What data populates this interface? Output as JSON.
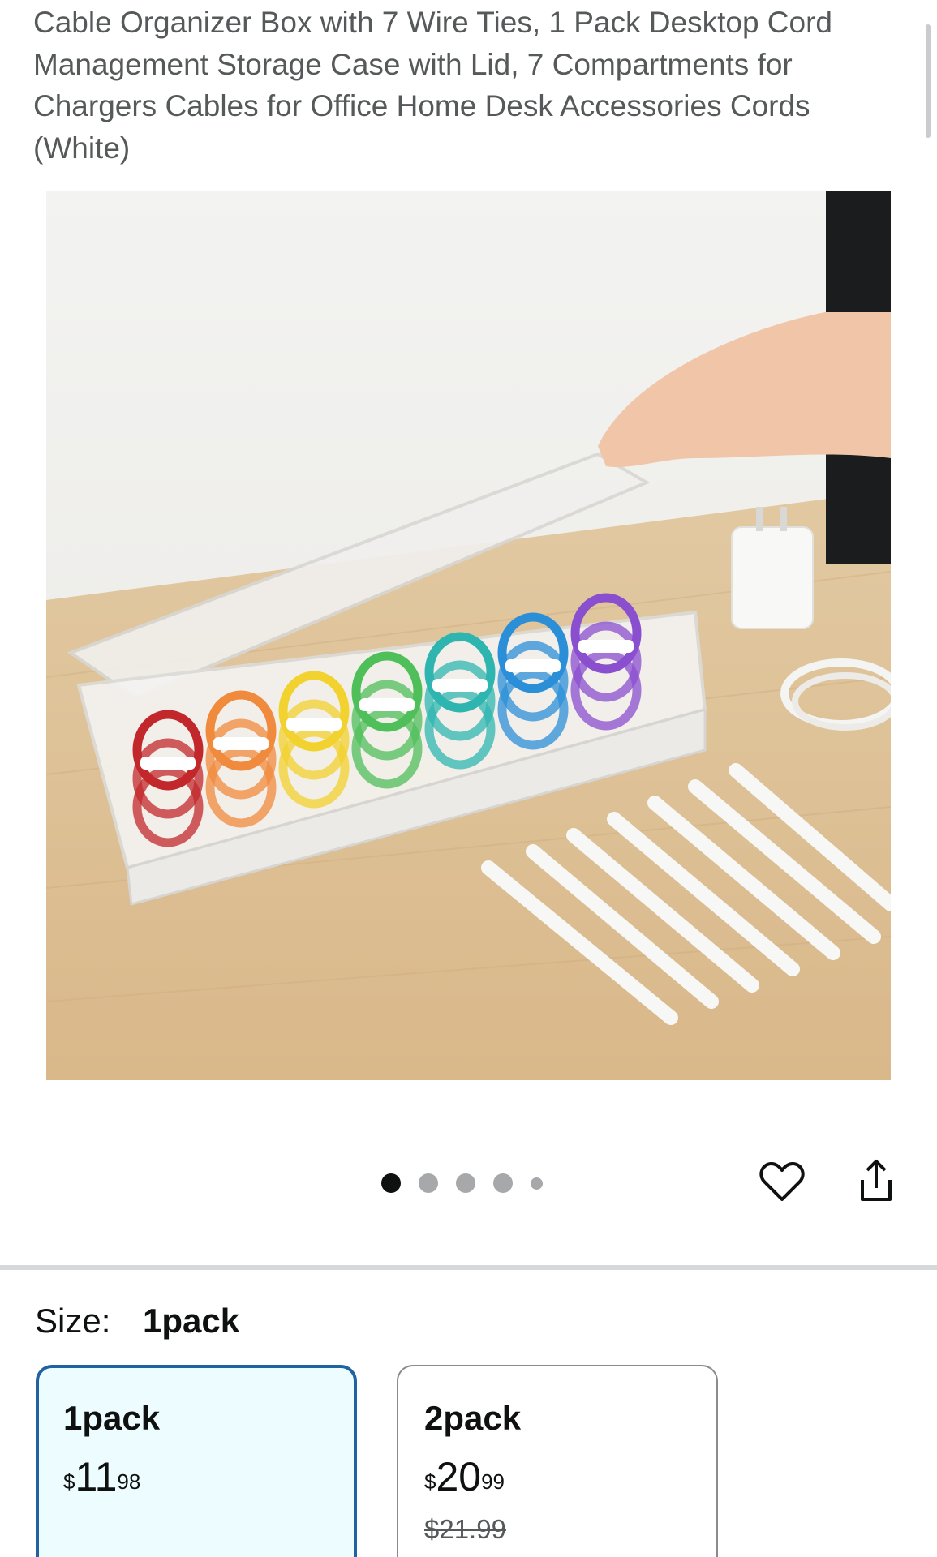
{
  "product": {
    "title": "Cable Organizer Box with 7 Wire Ties, 1 Pack Desktop Cord Management Storage Case with Lid, 7 Compartments for Chargers Cables for Office Home Desk Accessories Cords (White)"
  },
  "image": {
    "cable_colors": [
      "#c2282b",
      "#f08a3c",
      "#f2d22f",
      "#4fbf5a",
      "#2fb5b0",
      "#2b8fd8",
      "#8a4fcf"
    ]
  },
  "carousel": {
    "count": 5,
    "active_index": 0
  },
  "actions": {
    "favorite_icon": "heart-outline-icon",
    "share_icon": "share-icon"
  },
  "size": {
    "label": "Size:",
    "selected": "1pack"
  },
  "options": [
    {
      "name": "1pack",
      "price_symbol": "$",
      "price_whole": "11",
      "price_fraction": "98",
      "selected": true
    },
    {
      "name": "2pack",
      "price_symbol": "$",
      "price_whole": "20",
      "price_fraction": "99",
      "list_price": "$21.99",
      "selected": false
    }
  ],
  "colors": {
    "selected_border": "#2162a1",
    "selected_background": "#edfdff",
    "title_text": "#565959",
    "divider": "#d5d9d9"
  }
}
